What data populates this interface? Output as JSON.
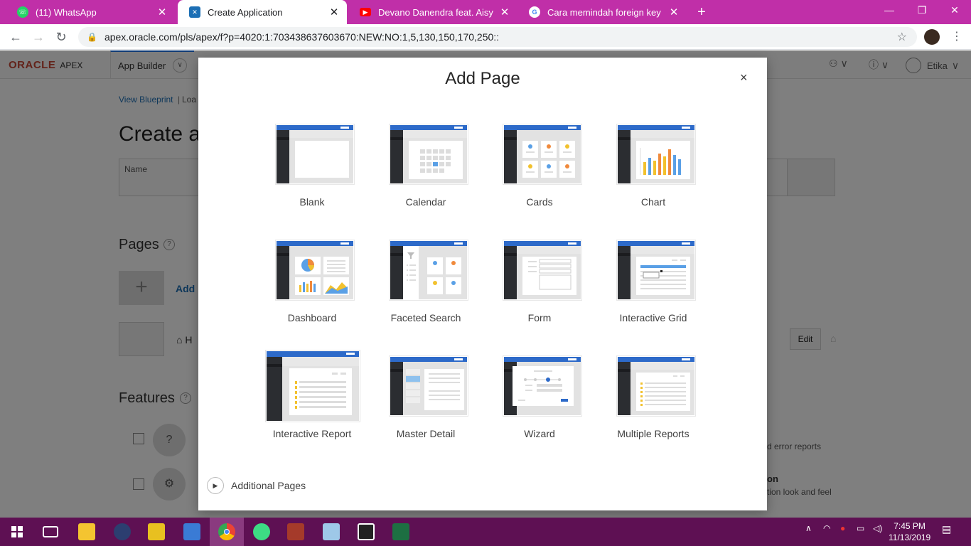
{
  "browser": {
    "tabs": [
      {
        "label": "(11) WhatsApp",
        "icon": "whatsapp-icon",
        "color": "#25d366"
      },
      {
        "label": "Create Application",
        "icon": "apex-icon",
        "color": "#1c6fb5"
      },
      {
        "label": "Devano Danendra feat. Aisyah Ad",
        "icon": "youtube-icon",
        "color": "#ff0000"
      },
      {
        "label": "Cara memindah foreign key - Per",
        "icon": "google-icon",
        "color": "#4285f4"
      }
    ],
    "url": "apex.oracle.com/pls/apex/f?p=4020:1:703438637603670:NEW:NO:1,5,130,150,170,250::",
    "new_tab": "+",
    "close_glyph": "✕"
  },
  "apex": {
    "logo": "ORACLE",
    "logo_sub": "APEX",
    "app_builder": "App Builder",
    "user": "Etika",
    "breadcrumb_view": "View Blueprint",
    "breadcrumb_load": "Loa",
    "page_title": "Create a",
    "name_label": "Name",
    "pages_heading": "Pages",
    "add_label": "Add",
    "home_label": "H",
    "edit_label": "Edit",
    "features_heading": "Features",
    "error_reports_text": "d error reports",
    "look_feel_title": "on",
    "look_feel_text": "tion look and feel"
  },
  "modal": {
    "title": "Add Page",
    "close": "×",
    "page_types": [
      {
        "label": "Blank",
        "type": "blank"
      },
      {
        "label": "Calendar",
        "type": "calendar"
      },
      {
        "label": "Cards",
        "type": "cards"
      },
      {
        "label": "Chart",
        "type": "chart"
      },
      {
        "label": "Dashboard",
        "type": "dashboard"
      },
      {
        "label": "Faceted Search",
        "type": "faceted"
      },
      {
        "label": "Form",
        "type": "form"
      },
      {
        "label": "Interactive Grid",
        "type": "grid"
      },
      {
        "label": "Interactive Report",
        "type": "report"
      },
      {
        "label": "Master Detail",
        "type": "master"
      },
      {
        "label": "Wizard",
        "type": "wizard"
      },
      {
        "label": "Multiple Reports",
        "type": "multi"
      }
    ],
    "additional_pages": "Additional Pages"
  },
  "taskbar": {
    "time": "7:45 PM",
    "date": "11/13/2019"
  }
}
